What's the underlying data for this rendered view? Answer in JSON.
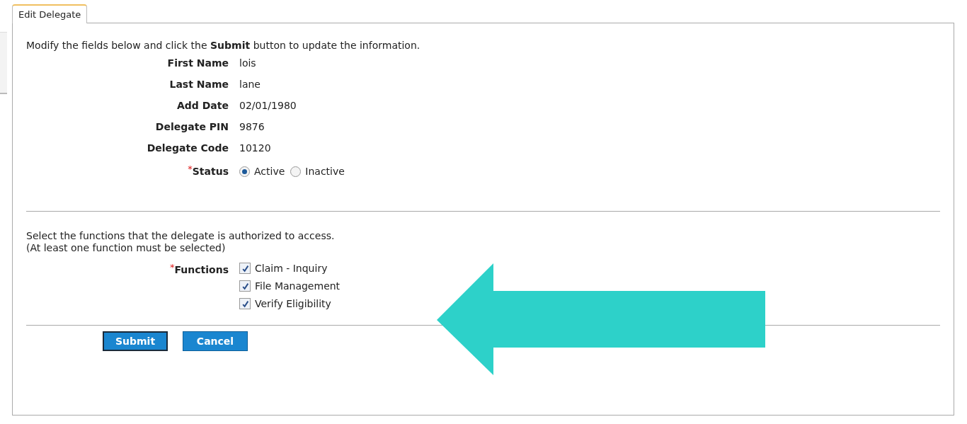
{
  "tab": {
    "label": "Edit Delegate",
    "selected": true
  },
  "intro": "Modify the fields below and click the **Submit** button to update the information.",
  "fields": [
    {
      "label": "First Name",
      "value": "lois"
    },
    {
      "label": "Last Name",
      "value": "lane"
    },
    {
      "label": "Add Date",
      "value": "02/01/1980"
    },
    {
      "label": "Delegate PIN",
      "value": "9876"
    },
    {
      "label": "Delegate Code",
      "value": "10120"
    }
  ],
  "status": {
    "required_mark": "*",
    "label": "Status",
    "options": [
      {
        "label": "Active",
        "selected": true
      },
      {
        "label": "Inactive",
        "selected": false
      }
    ]
  },
  "functions_note": [
    "Select the functions that the delegate is authorized to access.",
    "(At least one function must be selected)"
  ],
  "functions": {
    "required_mark": "*",
    "label": "Functions",
    "items": [
      {
        "label": "Claim - Inquiry",
        "checked": true
      },
      {
        "label": "File Management",
        "checked": true
      },
      {
        "label": "Verify Eligibility",
        "checked": true
      }
    ]
  },
  "buttons": [
    "Submit",
    "Cancel"
  ]
}
